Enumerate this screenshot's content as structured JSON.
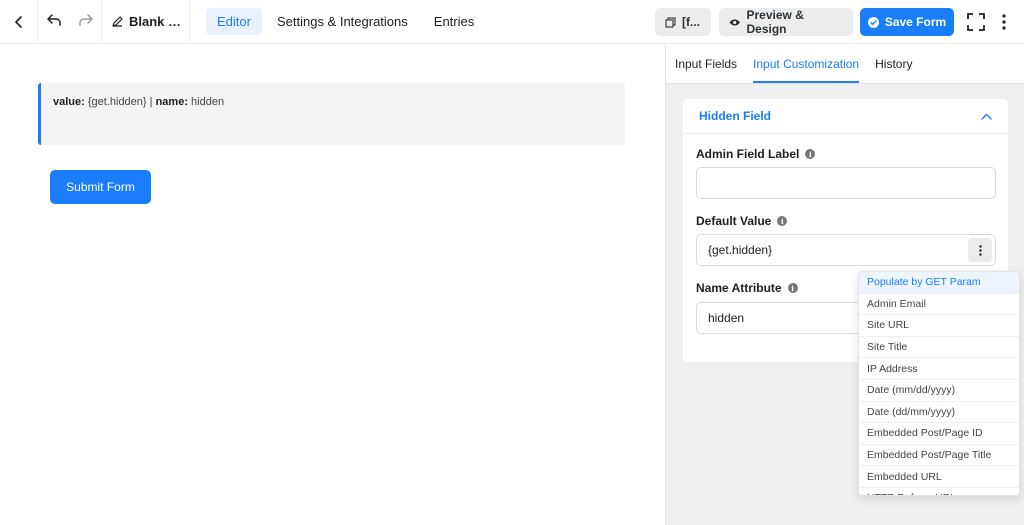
{
  "topbar": {
    "title": "Blank F...",
    "nav": [
      {
        "label": "Editor",
        "active": true
      },
      {
        "label": "Settings & Integrations",
        "active": false
      },
      {
        "label": "Entries",
        "active": false
      }
    ],
    "shortcode_label": "[f...",
    "preview_label": "Preview & Design",
    "save_label": "Save Form"
  },
  "canvas": {
    "hidden_field": {
      "value_key": "value:",
      "value": "{get.hidden}",
      "separator": "|",
      "name_key": "name:",
      "name": "hidden"
    },
    "submit_label": "Submit Form"
  },
  "sidebar": {
    "tabs": [
      {
        "label": "Input Fields",
        "active": false
      },
      {
        "label": "Input Customization",
        "active": true
      },
      {
        "label": "History",
        "active": false
      }
    ],
    "panel": {
      "title": "Hidden Field",
      "admin_label": {
        "label": "Admin Field Label",
        "value": ""
      },
      "default_value": {
        "label": "Default Value",
        "value": "{get.hidden}"
      },
      "name_attribute": {
        "label": "Name Attribute",
        "value": "hidden"
      }
    }
  },
  "dropdown": {
    "items": [
      "Populate by GET Param",
      "Admin Email",
      "Site URL",
      "Site Title",
      "IP Address",
      "Date (mm/dd/yyyy)",
      "Date (dd/mm/yyyy)",
      "Embedded Post/Page ID",
      "Embedded Post/Page Title",
      "Embedded URL",
      "HTTP Referer URL"
    ],
    "selected": "Populate by GET Param"
  },
  "colors": {
    "accent": "#1a7efb",
    "sidebar_bg": "#efefef"
  }
}
